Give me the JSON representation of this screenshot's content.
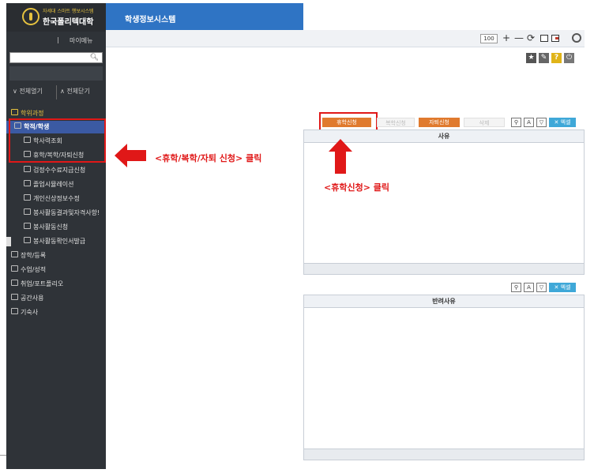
{
  "app": {
    "logo_tagline": "자세대 스마트 행보시스템",
    "logo_name": "한국폴리텍대학",
    "system_title": "학생정보시스템",
    "mymenu_sep": "|",
    "mymenu_label": "마이메뉴"
  },
  "sidebar": {
    "search_placeholder": "",
    "expand_all": "∨ 전체열기",
    "collapse_all": "∧ 전체닫기",
    "root": "학위과정",
    "groups": [
      {
        "label": "학적/학생",
        "selected": true,
        "items": [
          {
            "label": "학사력조회",
            "icon": "print-icon"
          },
          {
            "label": "휴학/복학/자퇴신청",
            "icon": "edit-icon"
          },
          {
            "label": "검정수수료지급신청",
            "icon": "edit-icon"
          },
          {
            "label": "졸업시뮬레이션",
            "icon": "edit-icon"
          },
          {
            "label": "개인신상정보수정",
            "icon": "edit-icon"
          },
          {
            "label": "봉사활동결과및자격사항!",
            "icon": "edit-icon"
          },
          {
            "label": "봉사활동신청",
            "icon": "edit-icon"
          },
          {
            "label": "봉사활동확인서발급",
            "icon": "edit-icon"
          }
        ]
      },
      {
        "label": "장학/등록"
      },
      {
        "label": "수업/성적"
      },
      {
        "label": "취업/포트폴리오"
      },
      {
        "label": "공간사용"
      },
      {
        "label": "기숙사"
      }
    ]
  },
  "toolbar": {
    "zoom": "100",
    "zoom_in": "+",
    "zoom_out": "—",
    "refresh": "⟳"
  },
  "buttons": {
    "leave_apply": "휴학신청",
    "return_apply": "복학신청",
    "withdraw_apply": "자퇴신청",
    "delete": "삭제",
    "excel": "✕ 엑셀"
  },
  "grid1": {
    "header": "사유"
  },
  "grid2": {
    "header": "반려사유"
  },
  "annotations": {
    "left": "<휴학/복학/자퇴 신청> 클릭",
    "up": "<휴학신청> 클릭",
    "color": "#e01818"
  },
  "colors": {
    "sidebar_bg": "#2f3338",
    "header_blue": "#2f74c4",
    "accent_orange": "#e07a2e",
    "selected_blue": "#3b5aa3"
  }
}
